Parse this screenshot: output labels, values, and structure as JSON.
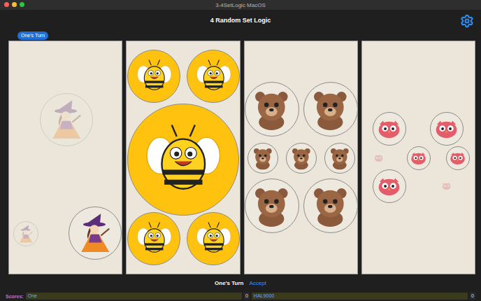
{
  "window": {
    "title": "3-4SetLogic MacOS"
  },
  "header": {
    "title": "4 Random Set Logic"
  },
  "turn_badge": {
    "label": "One's Turn"
  },
  "panels": [
    {
      "figure": "witch",
      "pieces": [
        {
          "size": "large",
          "faded": true
        },
        {
          "size": "small",
          "faded": true
        },
        {
          "size": "large",
          "faded": false
        }
      ]
    },
    {
      "figure": "bee",
      "pieces": [
        {
          "size": "medium",
          "faded": false
        },
        {
          "size": "medium",
          "faded": false
        },
        {
          "size": "big",
          "faded": false
        },
        {
          "size": "medium",
          "faded": false
        },
        {
          "size": "medium",
          "faded": false
        }
      ]
    },
    {
      "figure": "bear",
      "pieces": [
        {
          "size": "large",
          "faded": false
        },
        {
          "size": "large",
          "faded": false
        },
        {
          "size": "small",
          "faded": false
        },
        {
          "size": "small",
          "faded": false
        },
        {
          "size": "small",
          "faded": false
        },
        {
          "size": "large",
          "faded": false
        },
        {
          "size": "large",
          "faded": false
        }
      ]
    },
    {
      "figure": "owl",
      "pieces": [
        {
          "size": "medium",
          "faded": false
        },
        {
          "size": "medium",
          "faded": false
        },
        {
          "size": "tiny",
          "faded": true
        },
        {
          "size": "small",
          "faded": false
        },
        {
          "size": "small",
          "faded": false
        },
        {
          "size": "medium",
          "faded": false
        },
        {
          "size": "tiny",
          "faded": true
        }
      ]
    }
  ],
  "status": {
    "turn": "One's Turn",
    "accept": "Accept"
  },
  "scores": {
    "label": "Scores:",
    "players": [
      {
        "name": "One",
        "score": "0"
      },
      {
        "name": "HAL9000",
        "score": "0"
      }
    ]
  }
}
